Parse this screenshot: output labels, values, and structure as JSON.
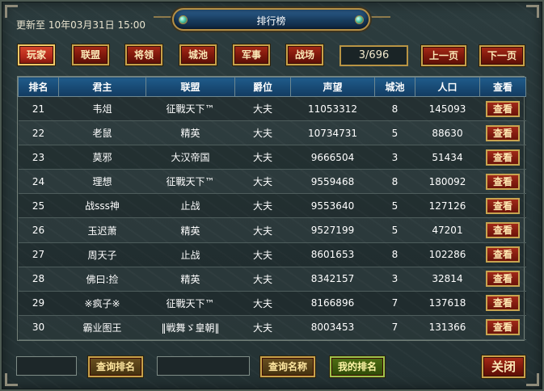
{
  "header": {
    "updated_label": "更新至 10年03月31日 15:00",
    "title": "排行榜"
  },
  "tabs": [
    {
      "label": "玩家",
      "active": true
    },
    {
      "label": "联盟"
    },
    {
      "label": "将领"
    },
    {
      "label": "城池"
    },
    {
      "label": "军事"
    },
    {
      "label": "战场"
    }
  ],
  "pagination": {
    "indicator": "3/696",
    "prev_label": "上一页",
    "next_label": "下一页"
  },
  "table": {
    "columns": [
      "排名",
      "君主",
      "联盟",
      "爵位",
      "声望",
      "城池",
      "人口",
      "查看"
    ],
    "view_label": "查看",
    "rows": [
      [
        "21",
        "韦俎",
        "征戰天下™",
        "大夫",
        "11053312",
        "8",
        "145093"
      ],
      [
        "22",
        "老鼠",
        "精英",
        "大夫",
        "10734731",
        "5",
        "88630"
      ],
      [
        "23",
        "莫邪",
        "大汉帝国",
        "大夫",
        "9666504",
        "3",
        "51434"
      ],
      [
        "24",
        "理想",
        "征戰天下™",
        "大夫",
        "9559468",
        "8",
        "180092"
      ],
      [
        "25",
        "战sss神",
        "止战",
        "大夫",
        "9553640",
        "5",
        "127126"
      ],
      [
        "26",
        "玉迟萧",
        "精英",
        "大夫",
        "9527199",
        "5",
        "47201"
      ],
      [
        "27",
        "周天子",
        "止战",
        "大夫",
        "8601653",
        "8",
        "102286"
      ],
      [
        "28",
        "佛曰:捡",
        "精英",
        "大夫",
        "8342157",
        "3",
        "32814"
      ],
      [
        "29",
        "※疯子※",
        "征戰天下™",
        "大夫",
        "8166896",
        "7",
        "137618"
      ],
      [
        "30",
        "霸业图王",
        "‖戦舞ゞ皇朝‖",
        "大夫",
        "8003453",
        "7",
        "131366"
      ]
    ]
  },
  "footer": {
    "rank_input_value": "",
    "query_rank_label": "查询排名",
    "name_input_value": "",
    "query_name_label": "查询名称",
    "my_rank_label": "我的排名",
    "close_label": "关闭"
  },
  "colors": {
    "tab_red": "#7c170b",
    "header_blue": "#123b61",
    "frame_gold": "#c7a149"
  }
}
